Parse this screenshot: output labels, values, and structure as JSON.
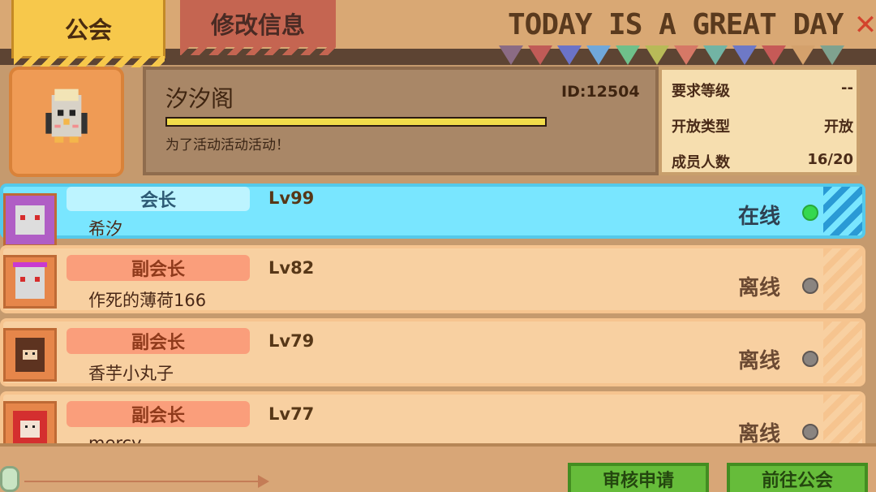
{
  "tabs": {
    "active": "公会",
    "inactive": "修改信息"
  },
  "banner": {
    "text": "TODAY IS A GREAT DAY",
    "colors": [
      "#c95755",
      "#d66e67",
      "#8e8ac2",
      "#6b73c8",
      "#70a8db",
      "#6fc08a",
      "#8ec87d",
      "#b1cb64",
      "#b8ba58",
      "#9aa9a7",
      "#8f9fb2",
      "#9f90b0",
      "#7f77c8",
      "#6b9bd5"
    ]
  },
  "guild": {
    "name": "汐汐阁",
    "id": "ID:12504",
    "motto": "为了活动活动活动！",
    "progress": 1
  },
  "stats": {
    "level_label": "要求等级",
    "level_value": "--",
    "type_label": "开放类型",
    "type_value": "开放",
    "members_label": "成员人数",
    "members_value": "16/20"
  },
  "members": [
    {
      "role": "会长",
      "level": "Lv99",
      "name": "希汐",
      "status": "在线",
      "online": true
    },
    {
      "role": "副会长",
      "level": "Lv82",
      "name": "作死的薄荷166",
      "status": "离线",
      "online": false
    },
    {
      "role": "副会长",
      "level": "Lv79",
      "name": "香芋小丸子",
      "status": "离线",
      "online": false
    },
    {
      "role": "副会长",
      "level": "Lv77",
      "name": "mercy",
      "status": "离线",
      "online": false
    }
  ],
  "buttons": {
    "review": "审核申请",
    "go_guild": "前往公会"
  },
  "colors": {
    "accent": "#f7c84b",
    "online": "#35d84f",
    "offline": "#8a8480"
  }
}
